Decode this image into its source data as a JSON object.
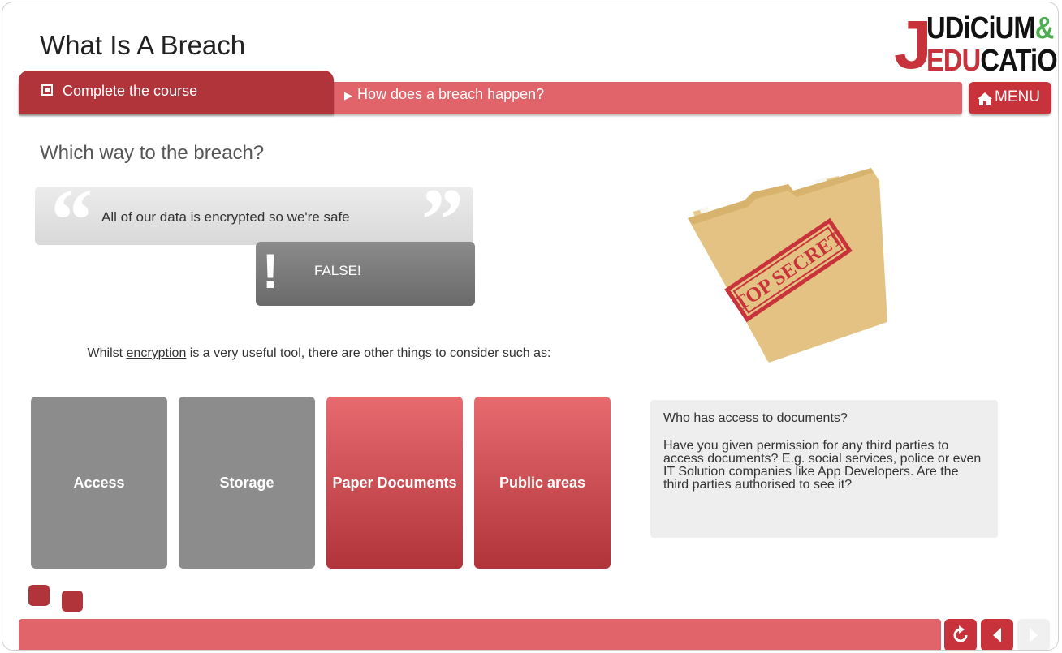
{
  "header": {
    "title": "What Is A Breach",
    "logo": {
      "line1": "UDiCiUM",
      "ampersand": "&",
      "line2_red": "EDU",
      "line2_black": "CATiON",
      "initial": "J"
    }
  },
  "nav": {
    "complete_label": "Complete the course",
    "next_label": "How does a breach happen?",
    "menu_label": "MENU"
  },
  "content": {
    "question": "Which way to the breach?",
    "quote": "All of our data is encrypted so we're safe",
    "verdict": "FALSE!",
    "verdict_mark": "!",
    "info_pre": "Whilst ",
    "info_link": "encryption",
    "info_post": " is a very useful tool, there are other things to consider such as:",
    "tiles": [
      {
        "label": "Access",
        "state": "viewed"
      },
      {
        "label": "Storage",
        "state": "viewed"
      },
      {
        "label": "Paper Documents",
        "state": "active"
      },
      {
        "label": "Public areas",
        "state": "active"
      }
    ],
    "detail_p1": "Who has access to documents?",
    "detail_p2": "Have you given permission for any third parties to access documents?  E.g. social services, police or even IT Solution companies like App Developers.  Are the third parties authorised to see it?",
    "folder_stamp": "TOP SECRET"
  },
  "colors": {
    "brand_red": "#c8323a",
    "bar_red": "#e0646a",
    "tile_grey": "#8c8c8c"
  },
  "footer": {
    "replay_icon": "replay-icon",
    "back_icon": "back-arrow-icon",
    "next_icon": "next-arrow-icon"
  }
}
